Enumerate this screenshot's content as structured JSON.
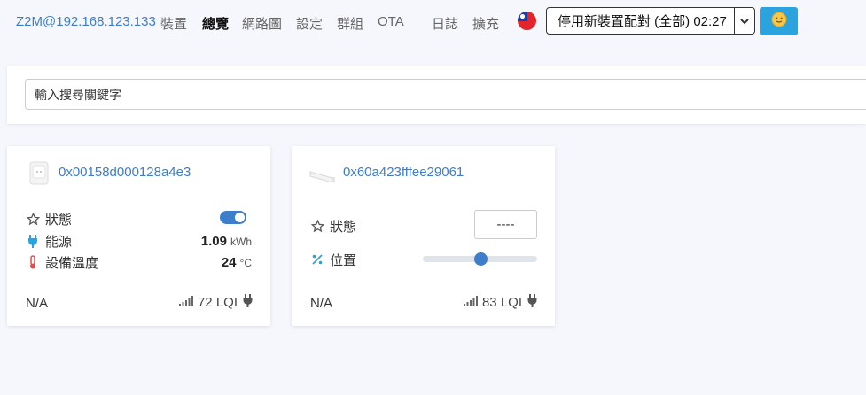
{
  "nav": {
    "brand": "Z2M@192.168.123.133",
    "links": [
      "裝置",
      "總覽",
      "網路圖",
      "設定",
      "群組",
      "OTA",
      "日誌",
      "擴充"
    ],
    "active": "總覽",
    "pair_button": "停用新裝置配對 (全部) 02:27"
  },
  "search": {
    "placeholder": "輸入搜尋關鍵字"
  },
  "devices": [
    {
      "id": "0x00158d000128a4e3",
      "state_label": "狀態",
      "state_on": true,
      "energy_label": "能源",
      "energy_value": "1.09",
      "energy_unit": "kWh",
      "temp_label": "設備溫度",
      "temp_value": "24",
      "temp_unit": "°C",
      "footer_left": "N/A",
      "lqi": "72 LQI"
    },
    {
      "id": "0x60a423fffee29061",
      "state_label": "狀態",
      "state_value": "----",
      "position_label": "位置",
      "position_value": 0.5,
      "footer_left": "N/A",
      "lqi": "83 LQI"
    }
  ],
  "colors": {
    "accent": "#3d7dca",
    "theme_button": "#2ba3de",
    "background": "#f5f7fc"
  }
}
